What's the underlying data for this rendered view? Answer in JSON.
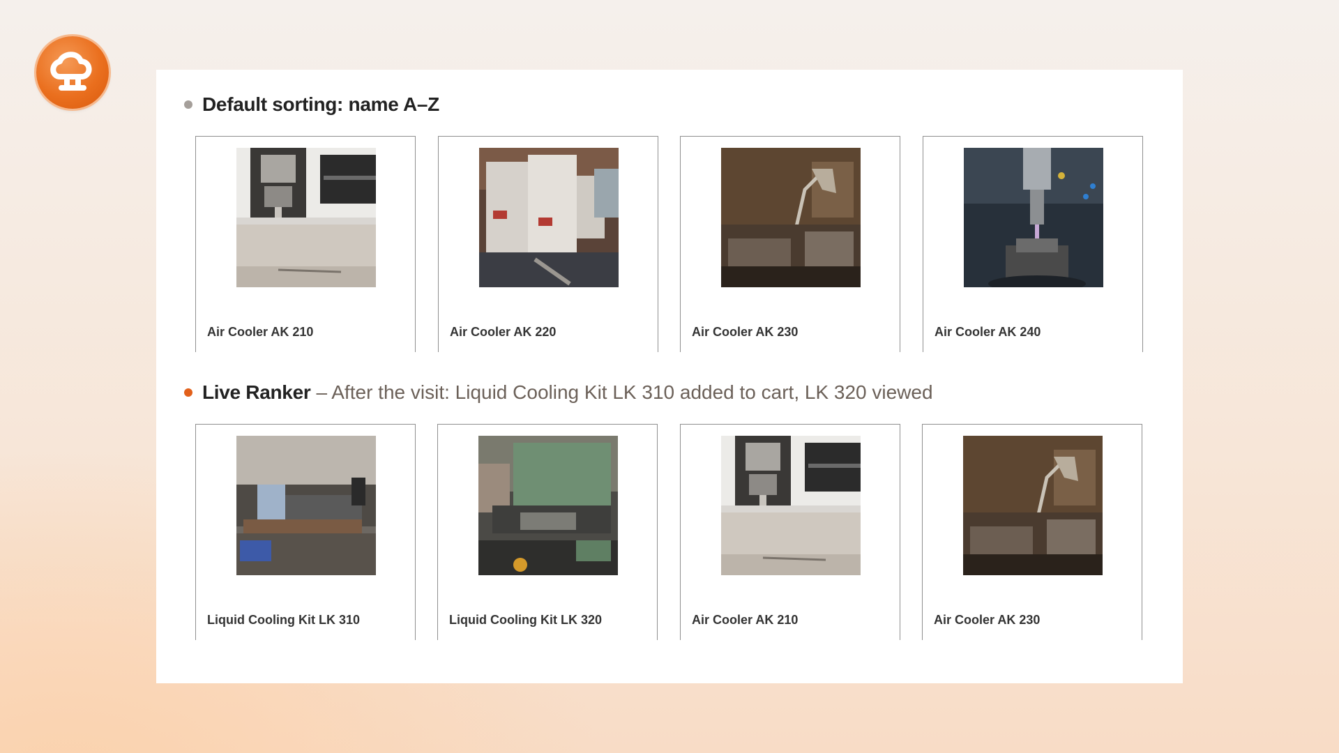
{
  "colors": {
    "accent": "#ea6f1e",
    "bullet_default": "#a59f9a",
    "bullet_live": "#e2601a"
  },
  "logo": {
    "icon": "logo-icon"
  },
  "sections": [
    {
      "title": "Default sorting: name A–Z",
      "subtitle": "",
      "products": [
        {
          "name": "Air Cooler AK 210",
          "image": "cnc-machine-photo"
        },
        {
          "name": "Air Cooler AK 220",
          "image": "embroidery-machine-photo"
        },
        {
          "name": "Air Cooler AK 230",
          "image": "workshop-lamp-photo"
        },
        {
          "name": "Air Cooler AK 240",
          "image": "milling-spindle-photo"
        }
      ]
    },
    {
      "title": "Live Ranker",
      "subtitle": "– After the visit: Liquid Cooling Kit LK 310 added to cart, LK 320 viewed",
      "products": [
        {
          "name": "Liquid Cooling Kit LK 310",
          "image": "lathe-workshop-photo"
        },
        {
          "name": "Liquid Cooling Kit LK 320",
          "image": "green-lathe-photo"
        },
        {
          "name": "Air Cooler AK 210",
          "image": "cnc-machine-photo"
        },
        {
          "name": "Air Cooler AK 230",
          "image": "workshop-lamp-photo"
        }
      ]
    }
  ]
}
